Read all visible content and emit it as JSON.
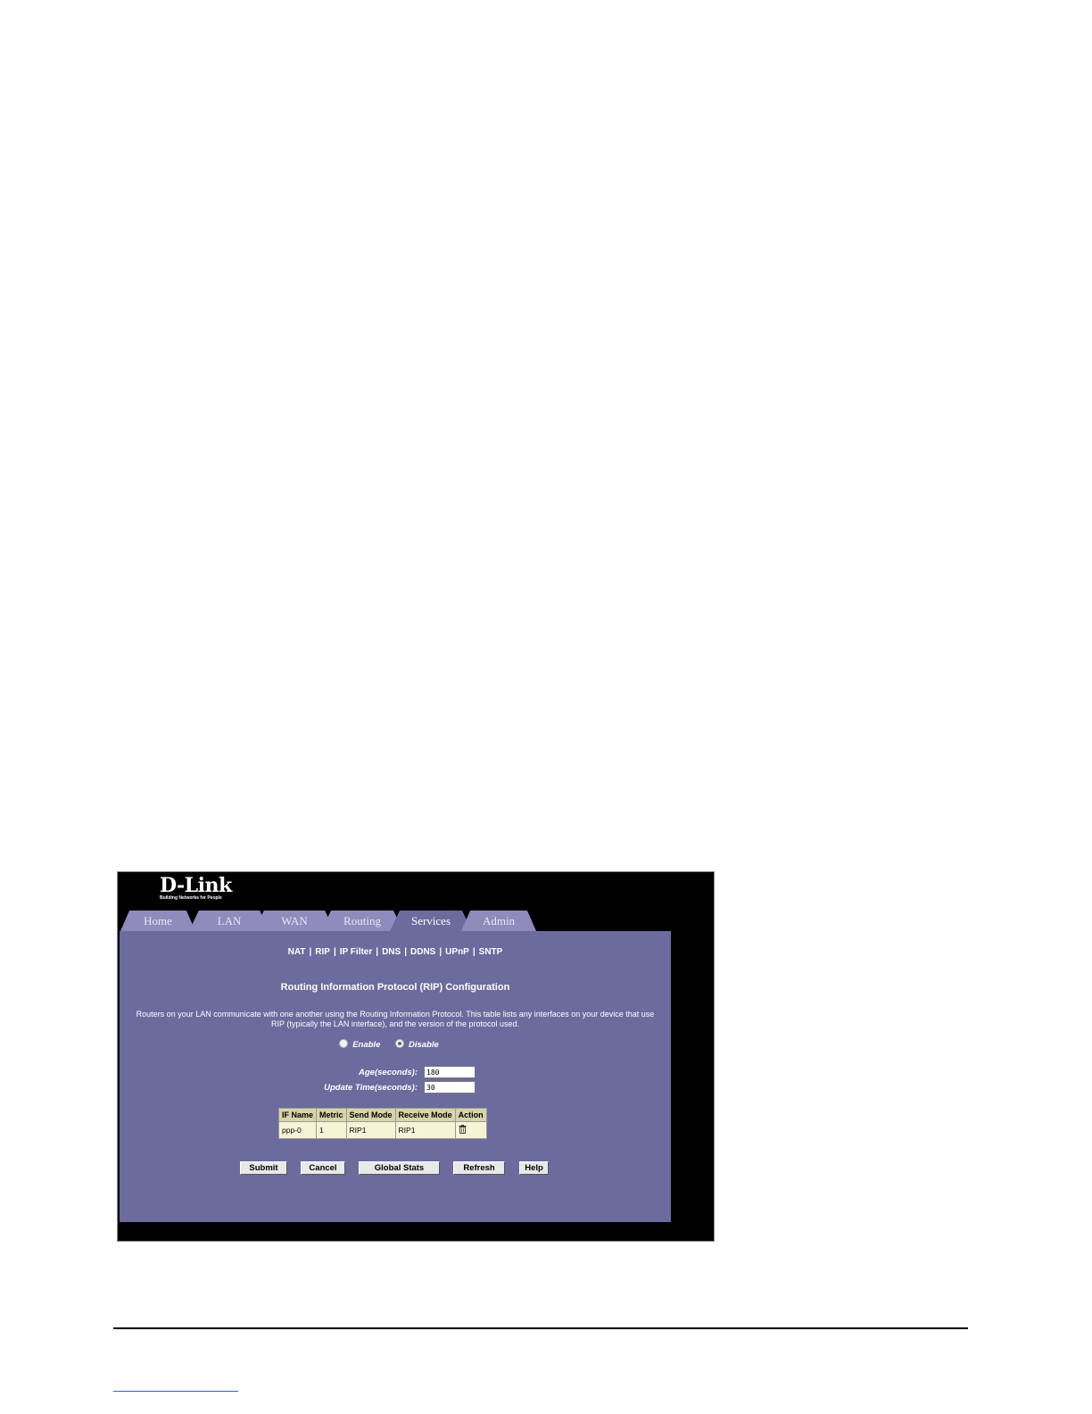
{
  "logo": {
    "brand": "D-Link",
    "tagline": "Building Networks for People"
  },
  "tabs": [
    {
      "label": "Home"
    },
    {
      "label": "LAN"
    },
    {
      "label": "WAN"
    },
    {
      "label": "Routing"
    },
    {
      "label": "Services",
      "active": true
    },
    {
      "label": "Admin"
    }
  ],
  "subnav": [
    "NAT",
    "RIP",
    "IP Filter",
    "DNS",
    "DDNS",
    "UPnP",
    "SNTP"
  ],
  "page": {
    "title": "Routing Information Protocol (RIP) Configuration",
    "description": "Routers on your LAN communicate with one another using the Routing Information Protocol. This table lists any interfaces on your device that use RIP (typically the LAN interface), and the version of the protocol used."
  },
  "rip_state": {
    "enable_label": "Enable",
    "disable_label": "Disable",
    "selected": "Disable"
  },
  "fields": {
    "age_label": "Age(seconds):",
    "age_value": "180",
    "update_label": "Update Time(seconds):",
    "update_value": "30"
  },
  "table": {
    "headers": [
      "IF Name",
      "Metric",
      "Send Mode",
      "Receive Mode",
      "Action"
    ],
    "rows": [
      {
        "if_name": "ppp-0",
        "metric": "1",
        "send_mode": "RIP1",
        "receive_mode": "RIP1",
        "action_icon": "trash-icon"
      }
    ]
  },
  "buttons": {
    "submit": "Submit",
    "cancel": "Cancel",
    "global_stats": "Global Stats",
    "refresh": "Refresh",
    "help": "Help"
  },
  "colors": {
    "panel": "#6b6b9e",
    "tab_inactive": "#8e8bbd",
    "table_header": "#d8d3a8",
    "table_cell": "#f7f3d6"
  }
}
